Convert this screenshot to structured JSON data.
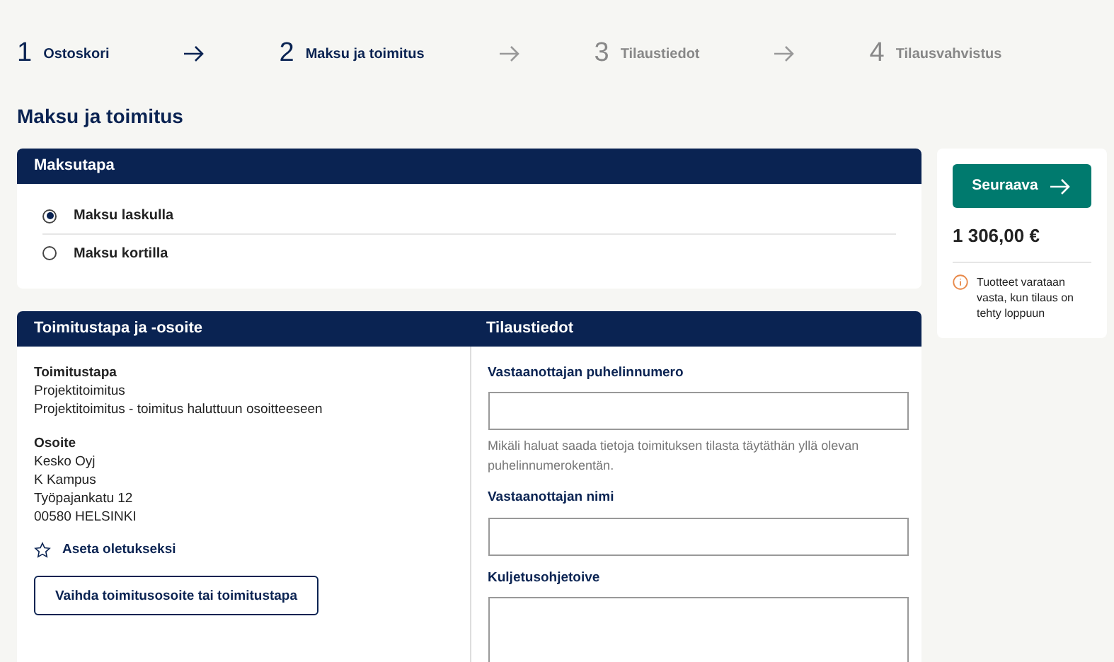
{
  "steps": [
    {
      "number": "1",
      "label": "Ostoskori",
      "active": true
    },
    {
      "number": "2",
      "label": "Maksu ja toimitus",
      "active": true
    },
    {
      "number": "3",
      "label": "Tilaustiedot",
      "active": false
    },
    {
      "number": "4",
      "label": "Tilausvahvistus",
      "active": false
    }
  ],
  "page_title": "Maksu ja toimitus",
  "payment": {
    "heading": "Maksutapa",
    "options": [
      {
        "label": "Maksu laskulla",
        "selected": true
      },
      {
        "label": "Maksu kortilla",
        "selected": false
      }
    ]
  },
  "delivery": {
    "heading": "Toimitustapa ja -osoite",
    "method_label": "Toimitustapa",
    "method_lines": [
      "Projektitoimitus",
      "Projektitoimitus - toimitus haluttuun osoitteeseen"
    ],
    "address_label": "Osoite",
    "address_lines": [
      "Kesko Oyj",
      "K Kampus",
      "Työpajankatu 12",
      "00580 HELSINKI"
    ],
    "default_link": "Aseta oletukseksi",
    "change_button": "Vaihda toimitusosoite tai toimitustapa"
  },
  "order_info": {
    "heading": "Tilaustiedot",
    "fields": [
      {
        "label": "Vastaanottajan puhelinnumero",
        "kind": "input",
        "hint": "Mikäli haluat saada tietoja toimituksen tilasta täytäthän yllä olevan puhelinnumerokentän."
      },
      {
        "label": "Vastaanottajan nimi",
        "kind": "input"
      },
      {
        "label": "Kuljetusohjetoive",
        "kind": "textarea"
      }
    ]
  },
  "summary": {
    "next_button": "Seuraava",
    "total": "1 306,00 €",
    "notice": "Tuotteet varataan vasta, kun tilaus on tehty loppuun"
  }
}
